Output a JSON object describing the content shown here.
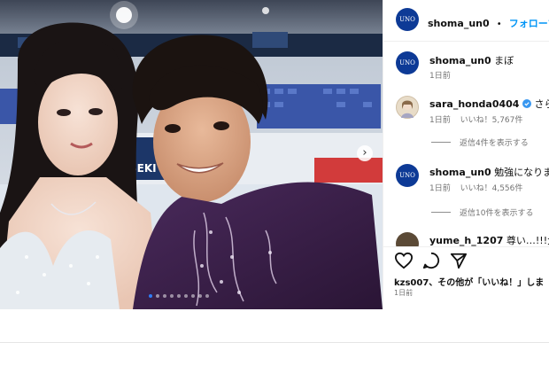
{
  "post": {
    "header": {
      "avatar_text": "UNO",
      "username": "shoma_un0",
      "separator": "•",
      "follow_label": "フォローする"
    },
    "caption": {
      "avatar_text": "UNO",
      "username": "shoma_un0",
      "text": "まぼ",
      "time": "1日前"
    },
    "comments": [
      {
        "username": "sara_honda0404",
        "text": "さらの",
        "time": "1日前",
        "likes": "いいね！5,767件",
        "replies": "返信4件を表示する",
        "verified": true
      },
      {
        "username": "shoma_un0",
        "text": "勉強になります",
        "time": "1日前",
        "likes": "いいね！4,556件",
        "replies": "返信10件を表示する",
        "avatar_text": "UNO"
      },
      {
        "username": "yume_h_1207",
        "text": "尊い…!!!大好"
      }
    ],
    "footer": {
      "liked_by": "kzs007、その他が「いいね！」しま",
      "time": "1日前"
    },
    "media": {
      "banner_text": "SEKI",
      "carousel_count": 9,
      "carousel_active": 0
    },
    "colors": {
      "accent": "#0095f6",
      "uno_blue": "#0d3a96",
      "outfit_purple": "#3b1f4a"
    },
    "icons": [
      "heart-icon",
      "comment-icon",
      "share-icon",
      "verified-icon",
      "next-arrow-icon"
    ]
  }
}
